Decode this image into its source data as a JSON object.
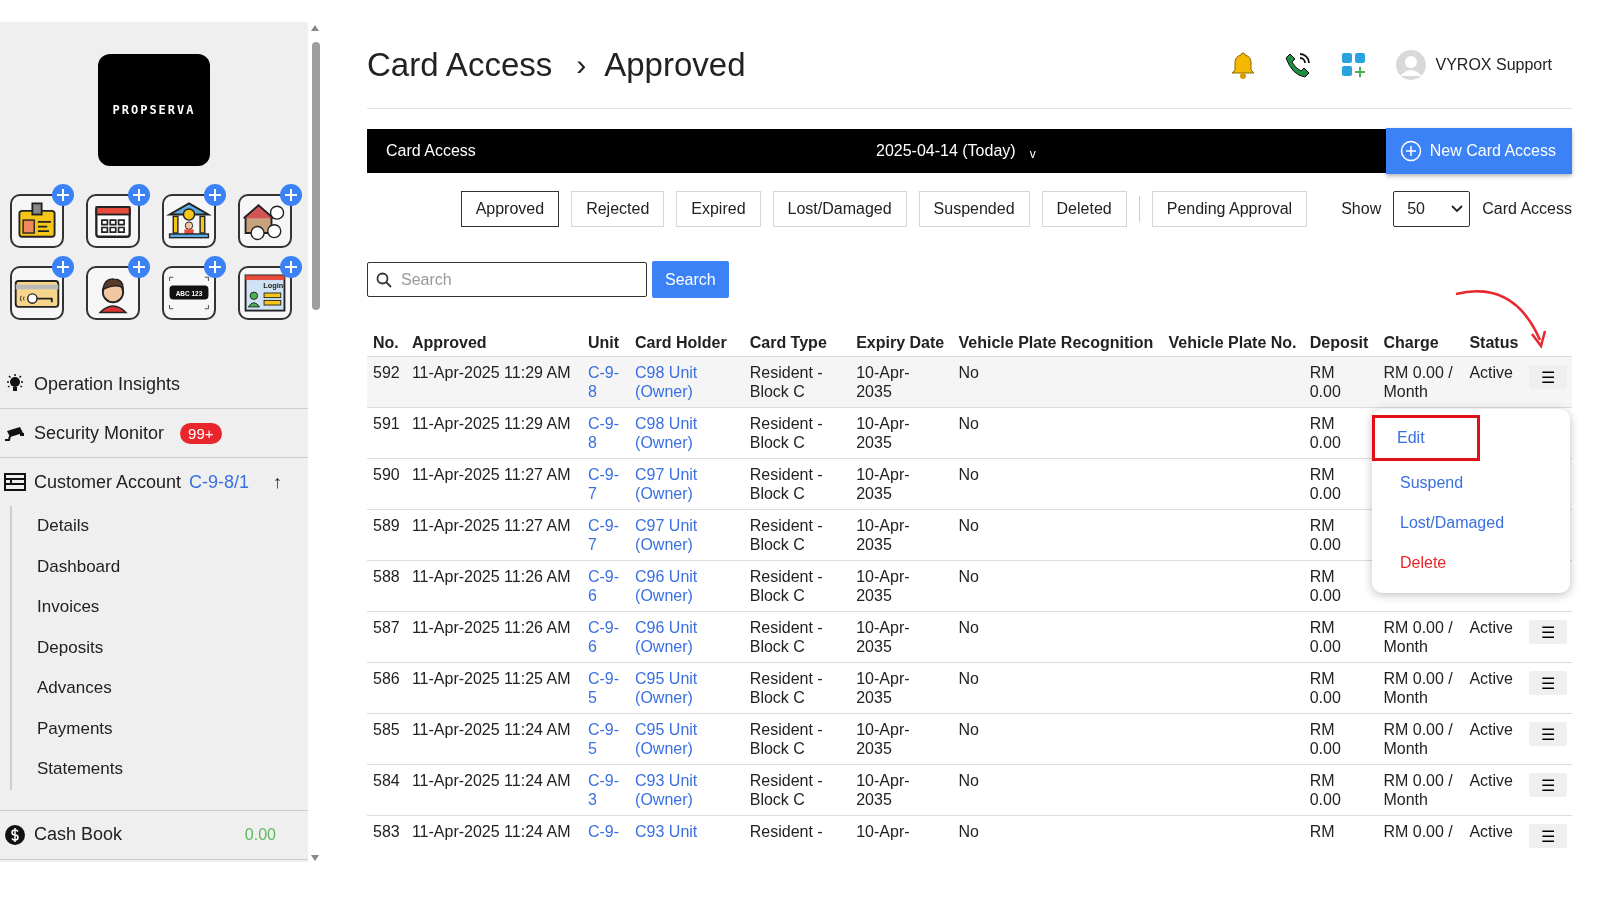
{
  "sidebar": {
    "logo": "PROPSERVA",
    "tiles": [
      {
        "kind": "idcard"
      },
      {
        "kind": "calendar"
      },
      {
        "kind": "bank"
      },
      {
        "kind": "house"
      },
      {
        "kind": "keycard"
      },
      {
        "kind": "person"
      },
      {
        "kind": "plate",
        "text": "ABC 123"
      },
      {
        "kind": "login",
        "text": "Login"
      }
    ],
    "items": [
      {
        "kind": "insights",
        "label": "Operation Insights"
      },
      {
        "kind": "security",
        "label": "Security Monitor",
        "badge": "99+"
      },
      {
        "kind": "account",
        "label": "Customer Account",
        "account": "C-9-8/1",
        "toggle": "↑",
        "expanded": true,
        "children": [
          {
            "label": "Details"
          },
          {
            "label": "Dashboard"
          },
          {
            "label": "Invoices"
          },
          {
            "label": "Deposits"
          },
          {
            "label": "Advances"
          },
          {
            "label": "Payments"
          },
          {
            "label": "Statements"
          }
        ]
      },
      {
        "kind": "cash",
        "label": "Cash Book",
        "value": "0.00"
      }
    ]
  },
  "header": {
    "breadcrumb": [
      "Card Access",
      "Approved"
    ],
    "separator": "›",
    "user": "VYROX Support"
  },
  "toolbar": {
    "title": "Card Access",
    "date": "2025-04-14 (Today)",
    "caret": "v",
    "new_button": "New Card Access"
  },
  "tabs": [
    {
      "label": "Approved",
      "selected": true
    },
    {
      "label": "Rejected",
      "selected": false
    },
    {
      "label": "Expired",
      "selected": false
    },
    {
      "label": "Lost/Damaged",
      "selected": false
    },
    {
      "label": "Suspended",
      "selected": false
    },
    {
      "label": "Deleted",
      "selected": false
    },
    {
      "label": "Pending Approval",
      "selected": false,
      "separated": true
    }
  ],
  "page_size": {
    "label": "Show",
    "value": "50",
    "suffix": "Card Access"
  },
  "search": {
    "placeholder": "Search",
    "button": "Search"
  },
  "table": {
    "columns": [
      "No.",
      "Approved",
      "Unit",
      "Card Holder",
      "Card Type",
      "Expiry Date",
      "Vehicle Plate Recognition",
      "Vehicle Plate No.",
      "Deposit",
      "Charge",
      "Status"
    ],
    "rows": [
      {
        "no": "592",
        "approved": "11-Apr-2025 11:29 AM",
        "unit": "C-9-8",
        "holder": "C98 Unit (Owner)",
        "card_type": "Resident - Block C",
        "expiry": "10-Apr-2035",
        "vpr": "No",
        "deposit": "RM 0.00",
        "charge": "RM 0.00 / Month",
        "status": "Active",
        "menu": "☰"
      },
      {
        "no": "591",
        "approved": "11-Apr-2025 11:29 AM",
        "unit": "C-9-8",
        "holder": "C98 Unit (Owner)",
        "card_type": "Resident - Block C",
        "expiry": "10-Apr-2035",
        "vpr": "No",
        "deposit": "RM 0.00"
      },
      {
        "no": "590",
        "approved": "11-Apr-2025 11:27 AM",
        "unit": "C-9-7",
        "holder": "C97 Unit (Owner)",
        "card_type": "Resident - Block C",
        "expiry": "10-Apr-2035",
        "vpr": "No",
        "deposit": "RM 0.00"
      },
      {
        "no": "589",
        "approved": "11-Apr-2025 11:27 AM",
        "unit": "C-9-7",
        "holder": "C97 Unit (Owner)",
        "card_type": "Resident - Block C",
        "expiry": "10-Apr-2035",
        "vpr": "No",
        "deposit": "RM 0.00"
      },
      {
        "no": "588",
        "approved": "11-Apr-2025 11:26 AM",
        "unit": "C-9-6",
        "holder": "C96 Unit (Owner)",
        "card_type": "Resident - Block C",
        "expiry": "10-Apr-2035",
        "vpr": "No",
        "deposit": "RM 0.00"
      },
      {
        "no": "587",
        "approved": "11-Apr-2025 11:26 AM",
        "unit": "C-9-6",
        "holder": "C96 Unit (Owner)",
        "card_type": "Resident - Block C",
        "expiry": "10-Apr-2035",
        "vpr": "No",
        "deposit": "RM 0.00",
        "charge": "RM 0.00 / Month",
        "status": "Active",
        "menu": "☰"
      },
      {
        "no": "586",
        "approved": "11-Apr-2025 11:25 AM",
        "unit": "C-9-5",
        "holder": "C95 Unit (Owner)",
        "card_type": "Resident - Block C",
        "expiry": "10-Apr-2035",
        "vpr": "No",
        "deposit": "RM 0.00",
        "charge": "RM 0.00 / Month",
        "status": "Active",
        "menu": "☰"
      },
      {
        "no": "585",
        "approved": "11-Apr-2025 11:24 AM",
        "unit": "C-9-5",
        "holder": "C95 Unit (Owner)",
        "card_type": "Resident - Block C",
        "expiry": "10-Apr-2035",
        "vpr": "No",
        "deposit": "RM 0.00",
        "charge": "RM 0.00 / Month",
        "status": "Active",
        "menu": "☰"
      },
      {
        "no": "584",
        "approved": "11-Apr-2025 11:24 AM",
        "unit": "C-9-3",
        "holder": "C93 Unit (Owner)",
        "card_type": "Resident - Block C",
        "expiry": "10-Apr-2035",
        "vpr": "No",
        "deposit": "RM 0.00",
        "charge": "RM 0.00 / Month",
        "status": "Active",
        "menu": "☰"
      },
      {
        "no": "583",
        "approved": "11-Apr-2025 11:24 AM",
        "unit": "C-9-",
        "holder": "C93 Unit",
        "card_type": "Resident -",
        "expiry": "10-Apr-",
        "vpr": "No",
        "deposit": "RM",
        "charge": "RM 0.00 /",
        "status": "Active",
        "menu": "☰"
      }
    ]
  },
  "row_menu": {
    "items": [
      {
        "label": "Edit",
        "kind": "normal",
        "highlighted": true
      },
      {
        "label": "Suspend",
        "kind": "normal",
        "highlighted": false
      },
      {
        "label": "Lost/Damaged",
        "kind": "normal",
        "highlighted": false
      },
      {
        "label": "Delete",
        "kind": "danger",
        "highlighted": false
      }
    ]
  }
}
